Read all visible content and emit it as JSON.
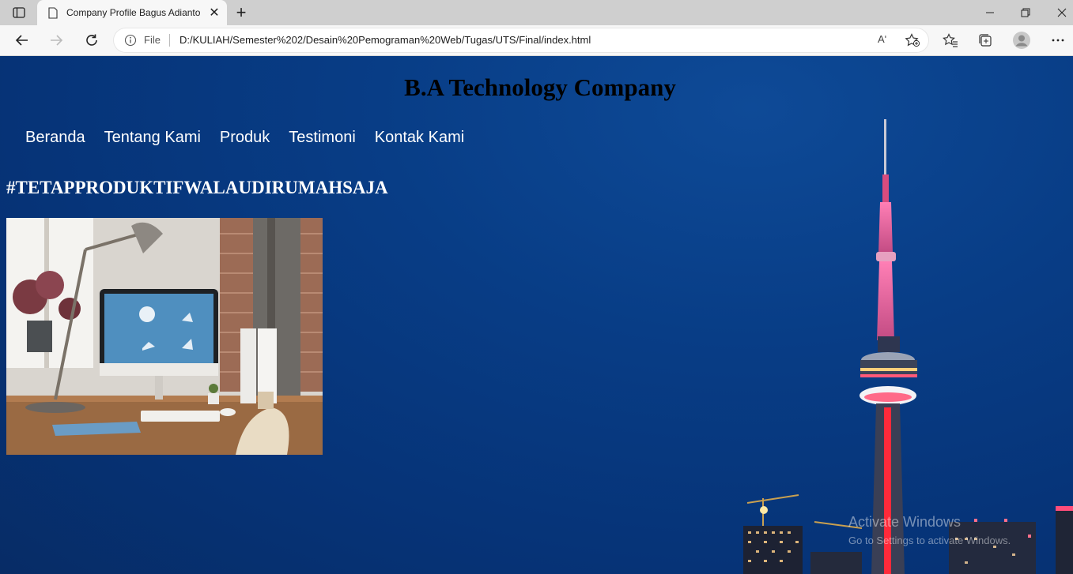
{
  "browser": {
    "tab_title": "Company Profile Bagus Adianto",
    "address_scheme_label": "File",
    "url": "D:/KULIAH/Semester%202/Desain%20Pemograman%20Web/Tugas/UTS/Final/index.html",
    "read_aloud_glyph": "Aʹ"
  },
  "page": {
    "company_name": "B.A Technology Company",
    "nav_items": [
      "Beranda",
      "Tentang Kami",
      "Produk",
      "Testimoni",
      "Kontak Kami"
    ],
    "slogan": "#TETAPPRODUKTIFWALAUDIRUMAHSAJA"
  },
  "os_watermark": {
    "line1": "Activate Windows",
    "line2": "Go to Settings to activate Windows."
  },
  "colors": {
    "page_background": "#073a82",
    "nav_text": "#ffffff",
    "title_text": "#000000",
    "tower_accent": "#e0457f"
  }
}
